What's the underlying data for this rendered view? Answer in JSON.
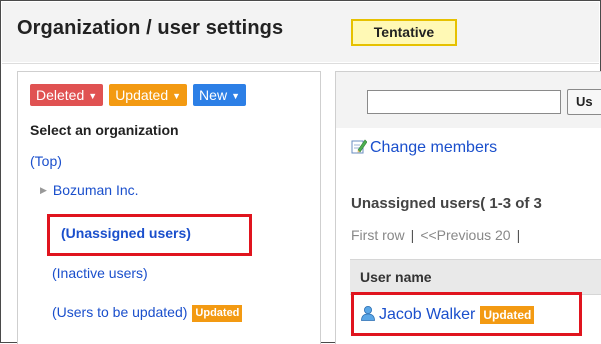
{
  "header": {
    "title": "Organization / user settings",
    "badge": "Tentative"
  },
  "filters": {
    "deleted": "Deleted",
    "updated": "Updated",
    "new": "New"
  },
  "left": {
    "select_label": "Select an organization",
    "top_link": "(Top)",
    "org_root": "Bozuman Inc.",
    "unassigned": "(Unassigned users)",
    "inactive": "(Inactive users)",
    "to_be_updated": "(Users to be updated)",
    "updated_tag": "Updated"
  },
  "right": {
    "search_value": "",
    "search_button": "Us",
    "change_members": "Change members",
    "heading": "Unassigned users( 1-3 of 3",
    "pager_first": "First row",
    "pager_sep": "|",
    "pager_prev": "<<Previous 20",
    "list_header": "User name",
    "users": [
      {
        "name": "Jacob Walker",
        "tag": "Updated"
      }
    ]
  },
  "colors": {
    "deleted": "#e05252",
    "updated": "#f39a12",
    "new": "#2c7fe6",
    "highlight": "#e0141e",
    "link": "#1a4fcc",
    "badge_border": "#e6c100",
    "badge_bg": "#fff9b5"
  }
}
